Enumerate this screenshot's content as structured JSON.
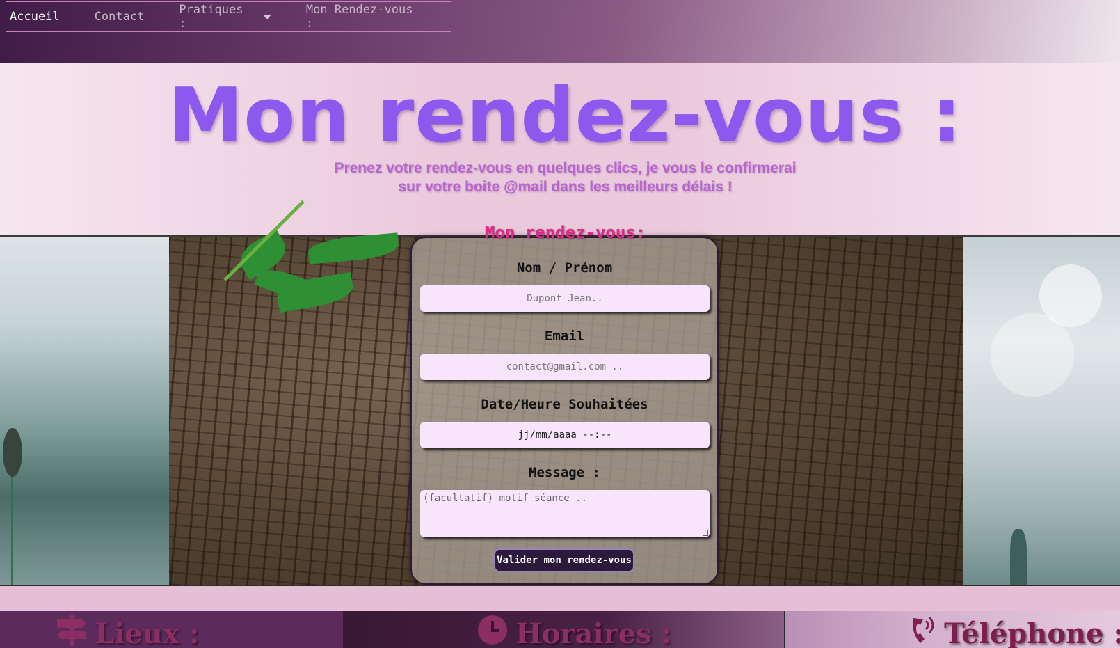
{
  "nav": {
    "items": [
      {
        "label": "Accueil",
        "active": true
      },
      {
        "label": "Contact",
        "active": false
      },
      {
        "label": "Pratiques :",
        "active": false,
        "has_dropdown": true
      },
      {
        "label": "Mon Rendez-vous :",
        "active": false
      }
    ]
  },
  "hero": {
    "title": "Mon rendez-vous :",
    "subtitle_line1": "Prenez votre rendez-vous en quelques clics, je vous le confirmerai",
    "subtitle_line2": "sur votre boite @mail dans les meilleurs délais !"
  },
  "form": {
    "heading": "Mon rendez-vous:",
    "name_label": "Nom / Prénom",
    "name_placeholder": "Dupont Jean..",
    "email_label": "Email",
    "email_placeholder": "contact@gmail.com ..",
    "datetime_label": "Date/Heure Souhaitées",
    "datetime_value": "jj/mm/aaaa --:--",
    "message_label": "Message :",
    "message_placeholder": "(facultatif) motif séance ..",
    "submit_label": "Valider mon rendez-vous"
  },
  "footer": {
    "places_title": "Lieux :",
    "places_icon": "signpost-icon",
    "hours_title": "Horaires :",
    "hours_icon": "clock-icon",
    "phone_title": "Téléphone :",
    "phone_icon": "phone-icon"
  },
  "colors": {
    "title": "#8c58ee",
    "subtitle": "#b765cf",
    "form_heading": "#e02a8a",
    "input_bg": "#f8e4fb",
    "button_bg": "#2c1a3c",
    "footer_text": "#8c2d63"
  }
}
